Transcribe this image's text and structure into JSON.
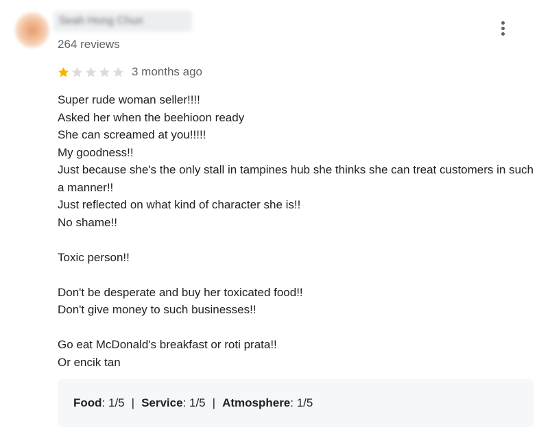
{
  "reviewer": {
    "name": "Seah Hong Chun",
    "review_count": "264 reviews"
  },
  "review": {
    "rating": 1,
    "max_rating": 5,
    "date": "3 months ago",
    "lines": [
      "Super rude woman seller!!!!",
      "Asked her when the beehioon ready",
      "She can screamed at you!!!!!",
      "My goodness!!",
      "Just because she's the only stall in tampines hub she thinks she can treat customers in such a manner!!",
      "Just reflected on what kind of character she is!!",
      "No shame!!",
      "",
      "Toxic person!!",
      "",
      "Don't be desperate and buy her toxicated food!!",
      "Don't give money to such businesses!!",
      "",
      "Go eat McDonald's breakfast or roti prata!!",
      "Or encik tan"
    ]
  },
  "sub_ratings": {
    "food_label": "Food",
    "food_value": ": 1/5",
    "service_label": "Service",
    "service_value": ": 1/5",
    "atmosphere_label": "Atmosphere",
    "atmosphere_value": ": 1/5",
    "separator": "|"
  },
  "colors": {
    "star_filled": "#f4b400",
    "star_empty": "#dadce0",
    "secondary_text": "#5f6368",
    "box_bg": "#f6f7f8"
  },
  "icons": {
    "more": "more-vert-icon",
    "star": "star-icon"
  }
}
